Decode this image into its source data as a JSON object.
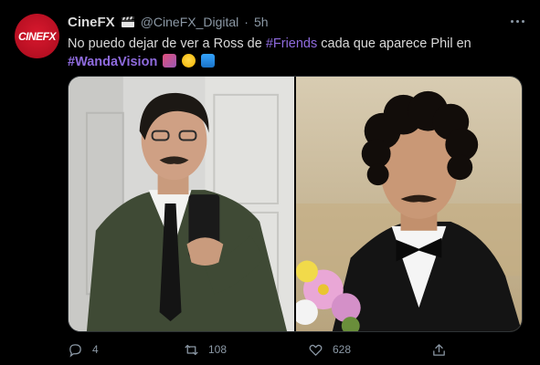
{
  "account": {
    "name": "CineFX",
    "handle": "@CineFX_Digital",
    "separator": "·",
    "time": "5h",
    "avatar_text": "CINEFX"
  },
  "tweet": {
    "text_part1": "No puedo dejar de ver a Ross de ",
    "hashtag1": "#Friends",
    "text_part2": " cada que aparece Phil en",
    "hashtag2": "#WandaVision"
  },
  "media": {
    "left_photo": "man-in-green-suit-selfie",
    "right_photo": "man-in-tuxedo-with-flowers"
  },
  "actions": {
    "reply_count": "4",
    "retweet_count": "108",
    "like_count": "628"
  },
  "colors": {
    "background": "#000000",
    "text": "#d9d9d9",
    "muted": "#8b98a5",
    "hashtag": "#8f6bde",
    "avatar": "#c8102e"
  },
  "icons": [
    "clapperboard-icon",
    "more-icon",
    "reply-icon",
    "retweet-icon",
    "like-icon",
    "share-icon"
  ]
}
